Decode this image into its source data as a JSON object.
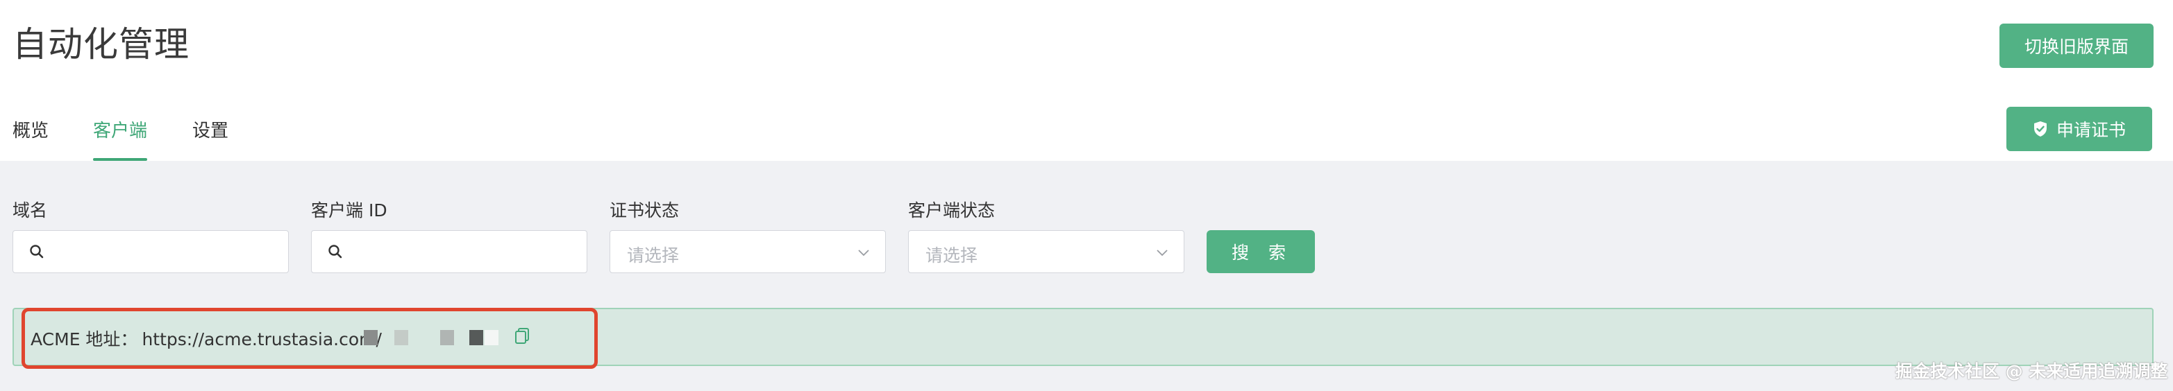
{
  "header": {
    "title": "自动化管理",
    "switch_button": "切换旧版界面",
    "apply_button": "申请证书",
    "apply_icon": "shield-check-icon"
  },
  "tabs": [
    {
      "label": "概览",
      "active": false
    },
    {
      "label": "客户端",
      "active": true
    },
    {
      "label": "设置",
      "active": false
    }
  ],
  "filters": {
    "domain": {
      "label": "域名",
      "value": "",
      "icon": "search-icon"
    },
    "client_id": {
      "label": "客户端 ID",
      "value": "",
      "icon": "search-icon"
    },
    "cert_status": {
      "label": "证书状态",
      "placeholder": "请选择"
    },
    "client_status": {
      "label": "客户端状态",
      "placeholder": "请选择"
    },
    "search_button": "搜 索"
  },
  "acme": {
    "label": "ACME 地址：",
    "url": "https://acme.trustasia.com/",
    "copy_icon": "copy-icon"
  },
  "watermark": "掘金技术社区 @ 未来适用追溯调整",
  "colors": {
    "accent": "#52b285",
    "active_tab": "#3fa777",
    "acme_bg": "#d8e8e1",
    "highlight": "#e0452e"
  }
}
